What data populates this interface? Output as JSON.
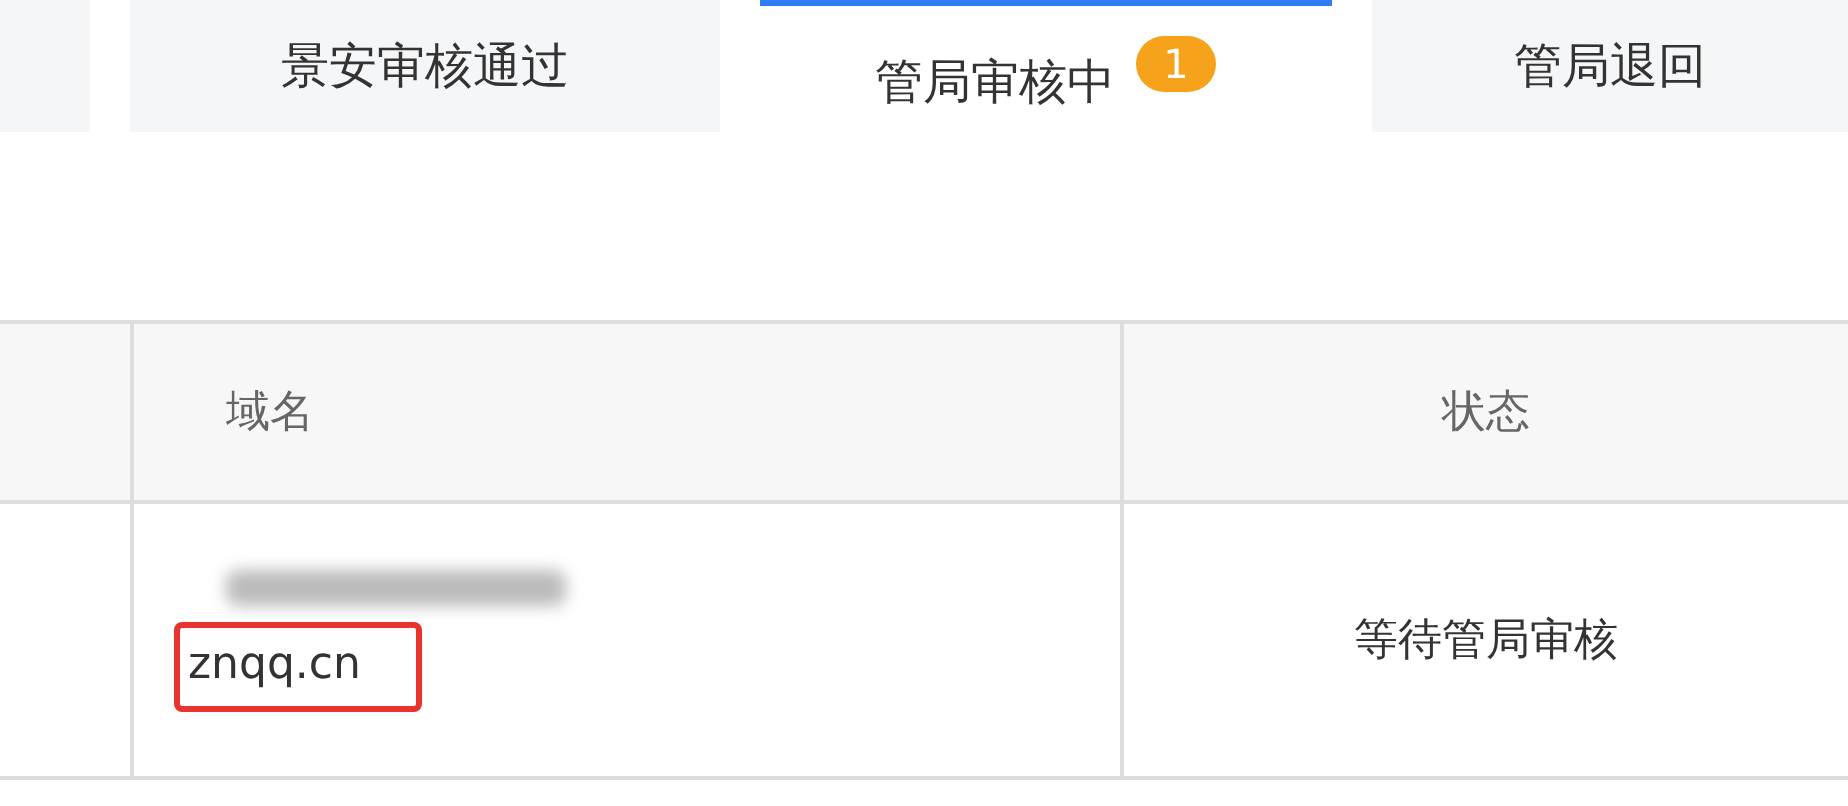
{
  "tabs": [
    {
      "selected": false
    },
    {
      "label": "景安审核通过",
      "selected": false
    },
    {
      "label": "管局审核中",
      "selected": true,
      "badge": "1"
    },
    {
      "label": "管局退回",
      "selected": false
    }
  ],
  "table": {
    "columns": [
      "域名",
      "状态"
    ],
    "rows": [
      {
        "domains": [
          {
            "kind": "redacted"
          },
          {
            "kind": "text",
            "text": "znqq.cn",
            "highlighted": true
          }
        ],
        "status": "等待管局审核"
      }
    ]
  }
}
